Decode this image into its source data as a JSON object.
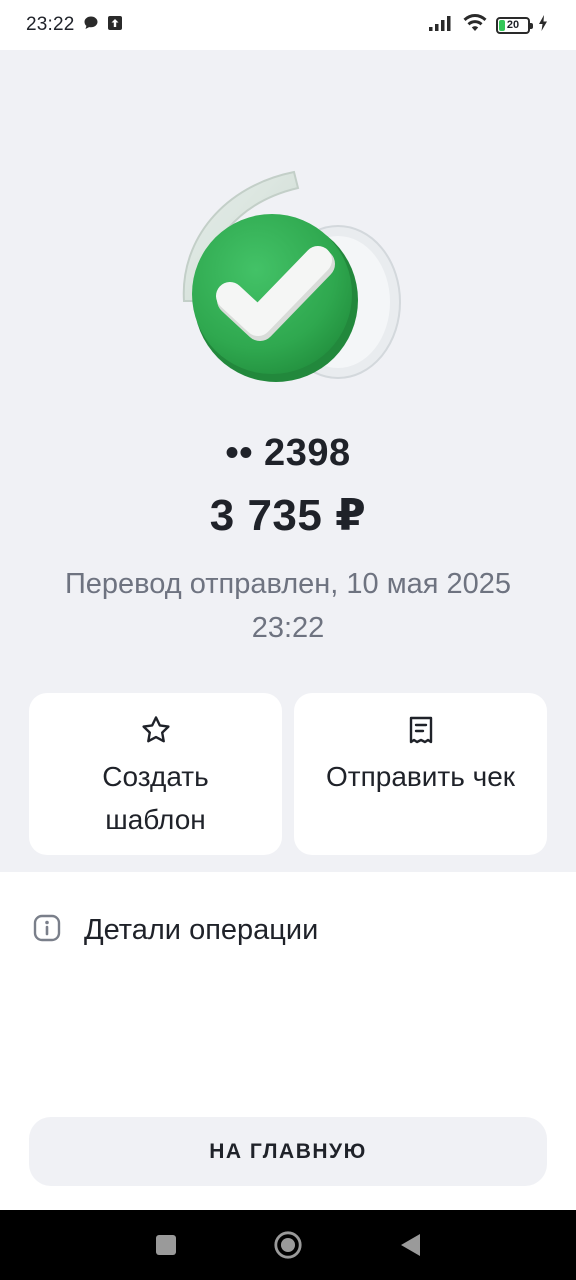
{
  "status_bar": {
    "time": "23:22",
    "battery": "20",
    "icons": [
      "chat-bubble-icon",
      "upload-icon",
      "signal-icon",
      "wifi-icon",
      "battery-icon",
      "charging-icon"
    ]
  },
  "transfer": {
    "card_number": "•• 2398",
    "amount": "3 735 ₽",
    "status_text": "Перевод отправлен, 10 мая 2025 23:22",
    "success_icon": "check-circle-icon"
  },
  "actions": {
    "create_template": {
      "label": "Создать шаблон",
      "icon": "star-icon"
    },
    "send_receipt": {
      "label": "Отправить чек",
      "icon": "receipt-icon"
    }
  },
  "details": {
    "label": "Детали операции",
    "icon": "info-icon"
  },
  "main_button": {
    "label": "НА ГЛАВНУЮ"
  },
  "nav_bar": {
    "icons": [
      "square-recents-icon",
      "circle-home-icon",
      "triangle-back-icon"
    ]
  },
  "colors": {
    "background_top": "#f0f1f5",
    "background_bottom": "#ffffff",
    "success_green": "#2fa84f",
    "text_primary": "#1f2229",
    "text_secondary": "#6e7380"
  }
}
